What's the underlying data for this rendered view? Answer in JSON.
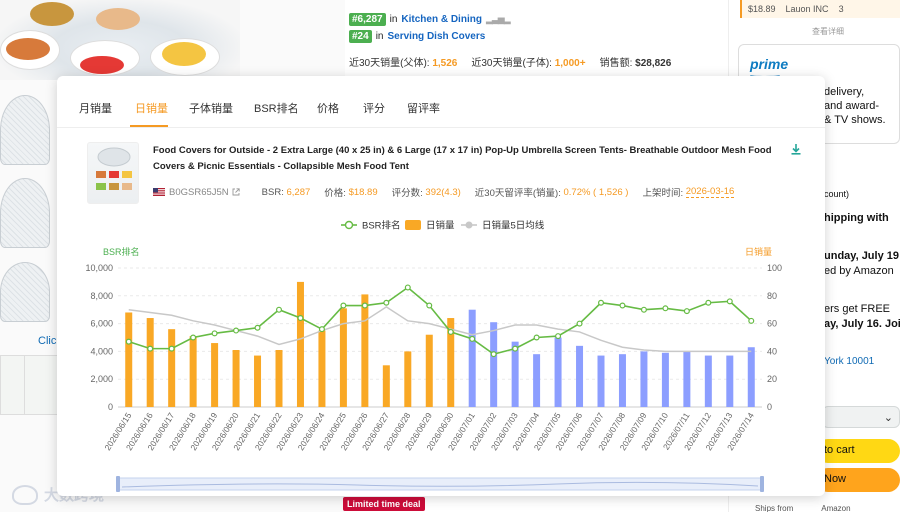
{
  "background": {
    "click_text": "Click",
    "rank1_badge": "#6,287",
    "rank1_in": "in",
    "rank1_category": "Kitchen & Dining",
    "rank2_badge": "#24",
    "rank2_in": "in",
    "rank2_category": "Serving Dish Covers",
    "stat_parent_label": "近30天销量(父体):",
    "stat_parent_value": "1,526",
    "stat_child_label": "近30天销量(子体):",
    "stat_child_value": "1,000+",
    "stat_sales_label": "销售额:",
    "stat_sales_value": "$28,826",
    "limited_deal": "Limited time deal",
    "seller_price": "$18.89",
    "seller_name": "Lauon INC",
    "seller_count": "3",
    "detail_link": "查看详细",
    "prime_logo": "prime",
    "right_lines": [
      "delivery,",
      "and award-",
      "& TV shows.",
      "count)",
      "hipping with",
      "unday, July 19",
      "ed by Amazon",
      "ers get FREE",
      "ay, July 16. Join",
      "York 10001"
    ],
    "add_to_cart": "to cart",
    "buy_now": "Now",
    "ships_from_label": "Ships from",
    "ships_from_value": "Amazon",
    "watermark": "大数跨境"
  },
  "popup": {
    "tabs": [
      "月销量",
      "日销量",
      "子体销量",
      "BSR排名",
      "价格",
      "评分",
      "留评率"
    ],
    "active_tab": "日销量",
    "product_title": "Food Covers for Outside - 2 Extra Large (40 x 25 in) & 6 Large (17 x 17 in) Pop-Up Umbrella Screen Tents- Breathable Outdoor Mesh Food Covers & Picnic Essentials - Collapsible Mesh Food Tent",
    "asin": "B0GSR65J5N",
    "bsr_label": "BSR:",
    "bsr_value": "6,287",
    "price_label": "价格:",
    "price_value": "$18.89",
    "rating_label": "评分数:",
    "rating_value": "392(4.3)",
    "review_rate_label": "近30天留评率(销量):",
    "review_rate_value": "0.72% ( 1,526 )",
    "listed_label": "上架时间:",
    "listed_value": "2026-03-16"
  },
  "chart_data": {
    "type": "bar",
    "legend": [
      "BSR排名",
      "日销量",
      "日销量5日均线"
    ],
    "ylabel_left": "BSR排名",
    "ylabel_right": "日销量",
    "ylim_left": [
      0,
      10000
    ],
    "ylim_right": [
      0,
      100
    ],
    "yticks_left": [
      "0",
      "2,000",
      "4,000",
      "6,000",
      "8,000",
      "10,000"
    ],
    "yticks_right": [
      "0",
      "20",
      "40",
      "60",
      "80",
      "100"
    ],
    "categories": [
      "2026/06/15",
      "2026/06/16",
      "2026/06/17",
      "2026/06/18",
      "2026/06/19",
      "2026/06/20",
      "2026/06/21",
      "2026/06/22",
      "2026/06/23",
      "2026/06/24",
      "2026/06/25",
      "2026/06/26",
      "2026/06/27",
      "2026/06/28",
      "2026/06/29",
      "2026/06/30",
      "2026/07/01",
      "2026/07/02",
      "2026/07/03",
      "2026/07/04",
      "2026/07/05",
      "2026/07/06",
      "2026/07/07",
      "2026/07/08",
      "2026/07/09",
      "2026/07/10",
      "2026/07/11",
      "2026/07/12",
      "2026/07/13",
      "2026/07/14"
    ],
    "series": [
      {
        "name": "日销量",
        "axis": "right",
        "values": [
          68,
          64,
          56,
          51,
          46,
          41,
          37,
          41,
          90,
          55,
          71,
          81,
          30,
          40,
          52,
          64,
          70,
          61,
          47,
          38,
          50,
          44,
          37,
          38,
          40,
          39,
          40,
          37,
          37,
          43
        ],
        "colors_by_month": {
          "2026/06": "#f9a825",
          "2026/07": "#8c9eff"
        }
      },
      {
        "name": "BSR排名",
        "axis": "left",
        "values": [
          4700,
          4200,
          4200,
          5000,
          5300,
          5500,
          5700,
          7000,
          6400,
          5600,
          7300,
          7300,
          7500,
          8600,
          7300,
          5400,
          4900,
          3800,
          4200,
          5000,
          5100,
          6000,
          7500,
          7300,
          7000,
          7100,
          6900,
          7500,
          7600,
          6200
        ]
      },
      {
        "name": "日销量5日均线",
        "axis": "right",
        "values": [
          70,
          68,
          66,
          62,
          59,
          55,
          51,
          45,
          49,
          55,
          60,
          62,
          72,
          62,
          60,
          56,
          52,
          55,
          59,
          59,
          56,
          54,
          48,
          43,
          41,
          40,
          40,
          40,
          40,
          40
        ]
      }
    ],
    "colors": {
      "bsr_line": "#66bb44",
      "bar_june": "#f9a825",
      "bar_july": "#8c9eff",
      "ma_line": "#c8c8c8"
    },
    "grid": true,
    "legend_position": "top-center"
  }
}
